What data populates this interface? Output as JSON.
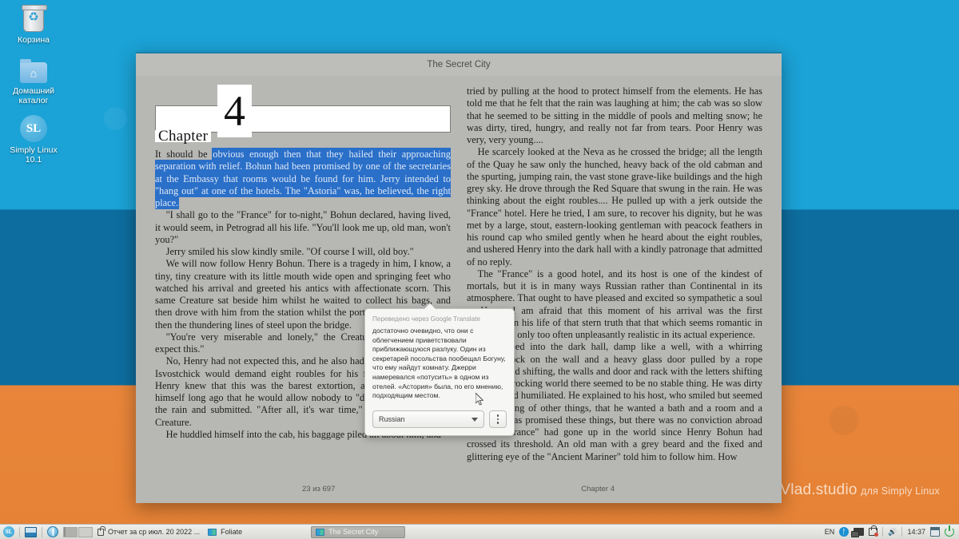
{
  "desktop": {
    "icons": [
      {
        "name": "trash-icon",
        "label": "Корзина"
      },
      {
        "name": "home-folder-icon",
        "label_line1": "Домашний",
        "label_line2": "каталог"
      },
      {
        "name": "simply-linux-icon",
        "badge": "SL",
        "label_line1": "Simply Linux",
        "label_line2": "10.1"
      }
    ],
    "watermark": {
      "line1": "Vlad.studio",
      "line2": "для Simply Linux"
    },
    "colors": {
      "sky": "#1ba2d6",
      "sea": "#0d6d9e",
      "sand": "#e8853a"
    }
  },
  "window": {
    "title": "The Secret City",
    "chapter": {
      "word": "Chapter",
      "number": "4"
    },
    "footer": {
      "progress": "23 из 697",
      "chapter_label": "Chapter 4"
    },
    "left_column": {
      "para1_plain": "It should be",
      "para1_selected": "obvious enough then that they hailed their approaching separation with relief. Bohun had been promised by one of the secretaries at the Embassy that rooms would be found for him. Jerry intended to \"hang out\" at one of the hotels. The \"Astoria\" was, he believed, the right place.",
      "para2": "\"I shall go to the \"France\" for to-night,\" Bohun declared, having lived, it would seem, in Petrograd all his life. \"You'll look me up, old man, won't you?\"",
      "para3": "Jerry smiled his slow kindly smile. \"Of course I will, old boy.\"",
      "para4": "We will now follow Henry Bohun. There is a tragedy in him, I know, a tiny, tiny creature with its little mouth wide open and springing feet who watched his arrival and greeted his antics with affectionate scorn. This same Creature sat beside him whilst he waited to collect his bags, and then drove with him from the station whilst the porters fetched a cab and then the thundering lines of steel upon the bridge.",
      "para5": "\"You're very miserable and lonely,\" the Creature said; \"you didn't expect this.\"",
      "para6": "No, Henry had not expected this, and he also had not expected that the Isvostchick would demand eight roubles for his fare to the \"France.\" Henry knew that this was the barest extortion, and he had sworn to himself long ago that he would allow nobody to \"do\" him. He looked at the rain and submitted. \"After all, it's war time,\" he whispered to the Creature.",
      "para7": "He huddled himself into the cab, his baggage piled all about him, and"
    },
    "right_column": {
      "para1": "tried by pulling at the hood to protect himself from the elements. He has told me that he felt that the rain was laughing at him; the cab was so slow that he seemed to be sitting in the middle of pools and melting snow; he was dirty, tired, hungry, and really not far from tears. Poor Henry was very, very young....",
      "para2": "He scarcely looked at the Neva as he crossed the bridge; all the length of the Quay he saw only the hunched, heavy back of the old cabman and the spurting, jumping rain, the vast stone grave-like buildings and the high grey sky. He drove through the Red Square that swung in the rain. He was thinking about the eight roubles.... He pulled up with a jerk outside the \"France\" hotel. Here he tried, I am sure, to recover his dignity, but he was met by a large, stout, eastern-looking gentleman with peacock feathers in his round cap who smiled gently when he heard about the eight roubles, and ushered Henry into the dark hall with a kindly patronage that admitted of no reply.",
      "para3": "The \"France\" is a good hotel, and its host is one of the kindest of mortals, but it is in many ways Russian rather than Continental in its atmosphere. That ought to have pleased and excited so sympathetic a soul as Henry. I am afraid that this moment of his arrival was the first realisation in his life of that stern truth that that which seems romantic in retrospect is only too often unpleasantly realistic in its actual experience.",
      "para4": "He stepped into the dark hall, damp like a well, with a whirring snarling clock on the wall and a heavy glass door pulled by a rope swinging and shifting, the walls and door and rack with the letters shifting too. In this rocking world there seemed to be no stable thing. He was dirty and tired and humiliated. He explained to his host, who smiled but seemed to be thinking of other things, that he wanted a bath and a room and a meal. He was promised these things, but there was no conviction abroad that the \"France\" had gone up in the world since Henry Bohun had crossed its threshold. An old man with a grey beard and the fixed and glittering eye of the \"Ancient Mariner\" told him to follow him. How"
    },
    "selection_color": "#2a6fc8"
  },
  "translate_popup": {
    "source_label": "Переведено через Google Translate",
    "translated_text": "достаточно очевидно, что они с облегчением приветствовали приближающуюся разлуку. Один из секретарей посольства пообещал Богуну, что ему найдут комнату. Джерри намеревался «потусить» в одном из отелей. «Астория» была, по его мнению, подходящим местом.",
    "language": "Russian"
  },
  "taskbar": {
    "start_badge": "SL",
    "items": [
      {
        "name": "taskbar-item-report",
        "label": "Отчет за ср июл. 20 2022 ..."
      },
      {
        "name": "taskbar-item-foliate",
        "label": "Foliate"
      }
    ],
    "active_window": "The Secret City",
    "tray": {
      "layout": "EN",
      "clock": "14:37"
    }
  }
}
